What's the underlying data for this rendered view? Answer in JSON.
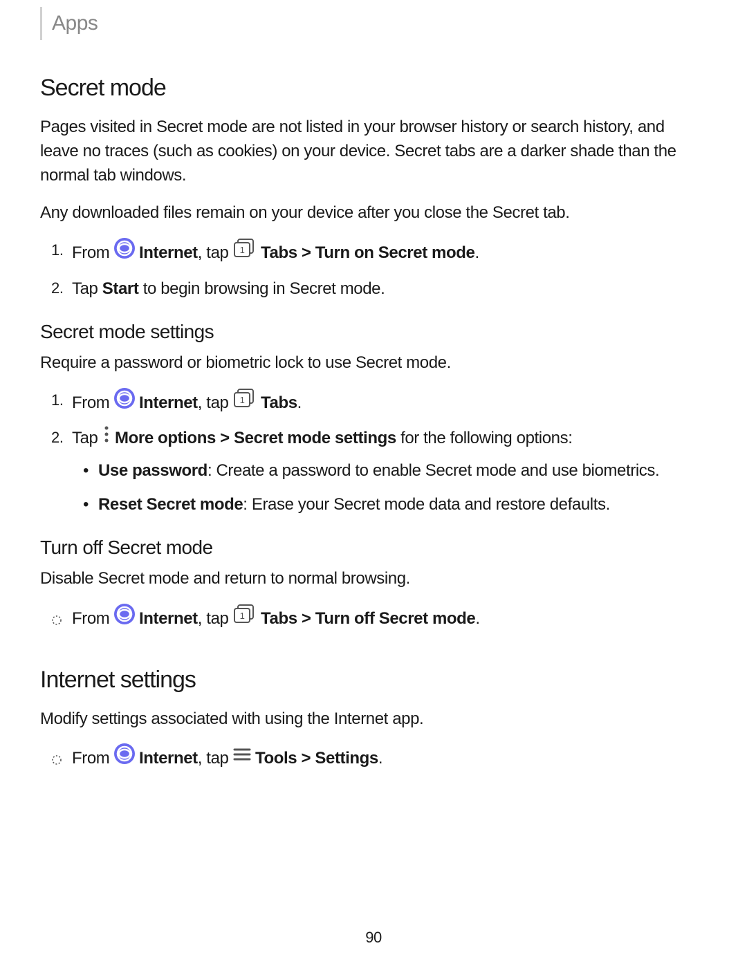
{
  "header": {
    "breadcrumb": "Apps"
  },
  "icons": {
    "internet": "internet-icon",
    "tabs": "tabs-icon",
    "more": "more-options-icon",
    "tools": "tools-icon",
    "dotted_circle": "dotted-circle-bullet"
  },
  "secret_mode": {
    "title": "Secret mode",
    "p1": "Pages visited in Secret mode are not listed in your browser history or search history, and leave no traces (such as cookies) on your device. Secret tabs are a darker shade than the normal tab windows.",
    "p2": "Any downloaded files remain on your device after you close the Secret tab.",
    "steps": {
      "s1_pre": "From ",
      "s1_internet": "Internet",
      "s1_mid": ", tap ",
      "s1_tabs_path": "Tabs > Turn on Secret mode",
      "s1_end": ".",
      "s2_pre": "Tap ",
      "s2_start": "Start",
      "s2_post": " to begin browsing in Secret mode."
    }
  },
  "secret_mode_settings": {
    "title": "Secret mode settings",
    "intro": "Require a password or biometric lock to use Secret mode.",
    "s1_pre": "From ",
    "s1_internet": "Internet",
    "s1_mid": ", tap ",
    "s1_tabs": "Tabs",
    "s1_end": ".",
    "s2_pre": "Tap ",
    "s2_path": "More options > Secret mode settings",
    "s2_post": " for the following options:",
    "opt1_label": "Use password",
    "opt1_desc": ": Create a password to enable Secret mode and use biometrics.",
    "opt2_label": "Reset Secret mode",
    "opt2_desc": ": Erase your Secret mode data and restore defaults."
  },
  "turn_off": {
    "title": "Turn off Secret mode",
    "intro": "Disable Secret mode and return to normal browsing.",
    "pre": "From ",
    "internet": "Internet",
    "mid": ", tap ",
    "path": "Tabs > Turn off Secret mode",
    "end": "."
  },
  "internet_settings": {
    "title": "Internet settings",
    "intro": "Modify settings associated with using the Internet app.",
    "pre": "From ",
    "internet": "Internet",
    "mid": ", tap ",
    "path": "Tools > Settings",
    "end": "."
  },
  "page_number": "90"
}
